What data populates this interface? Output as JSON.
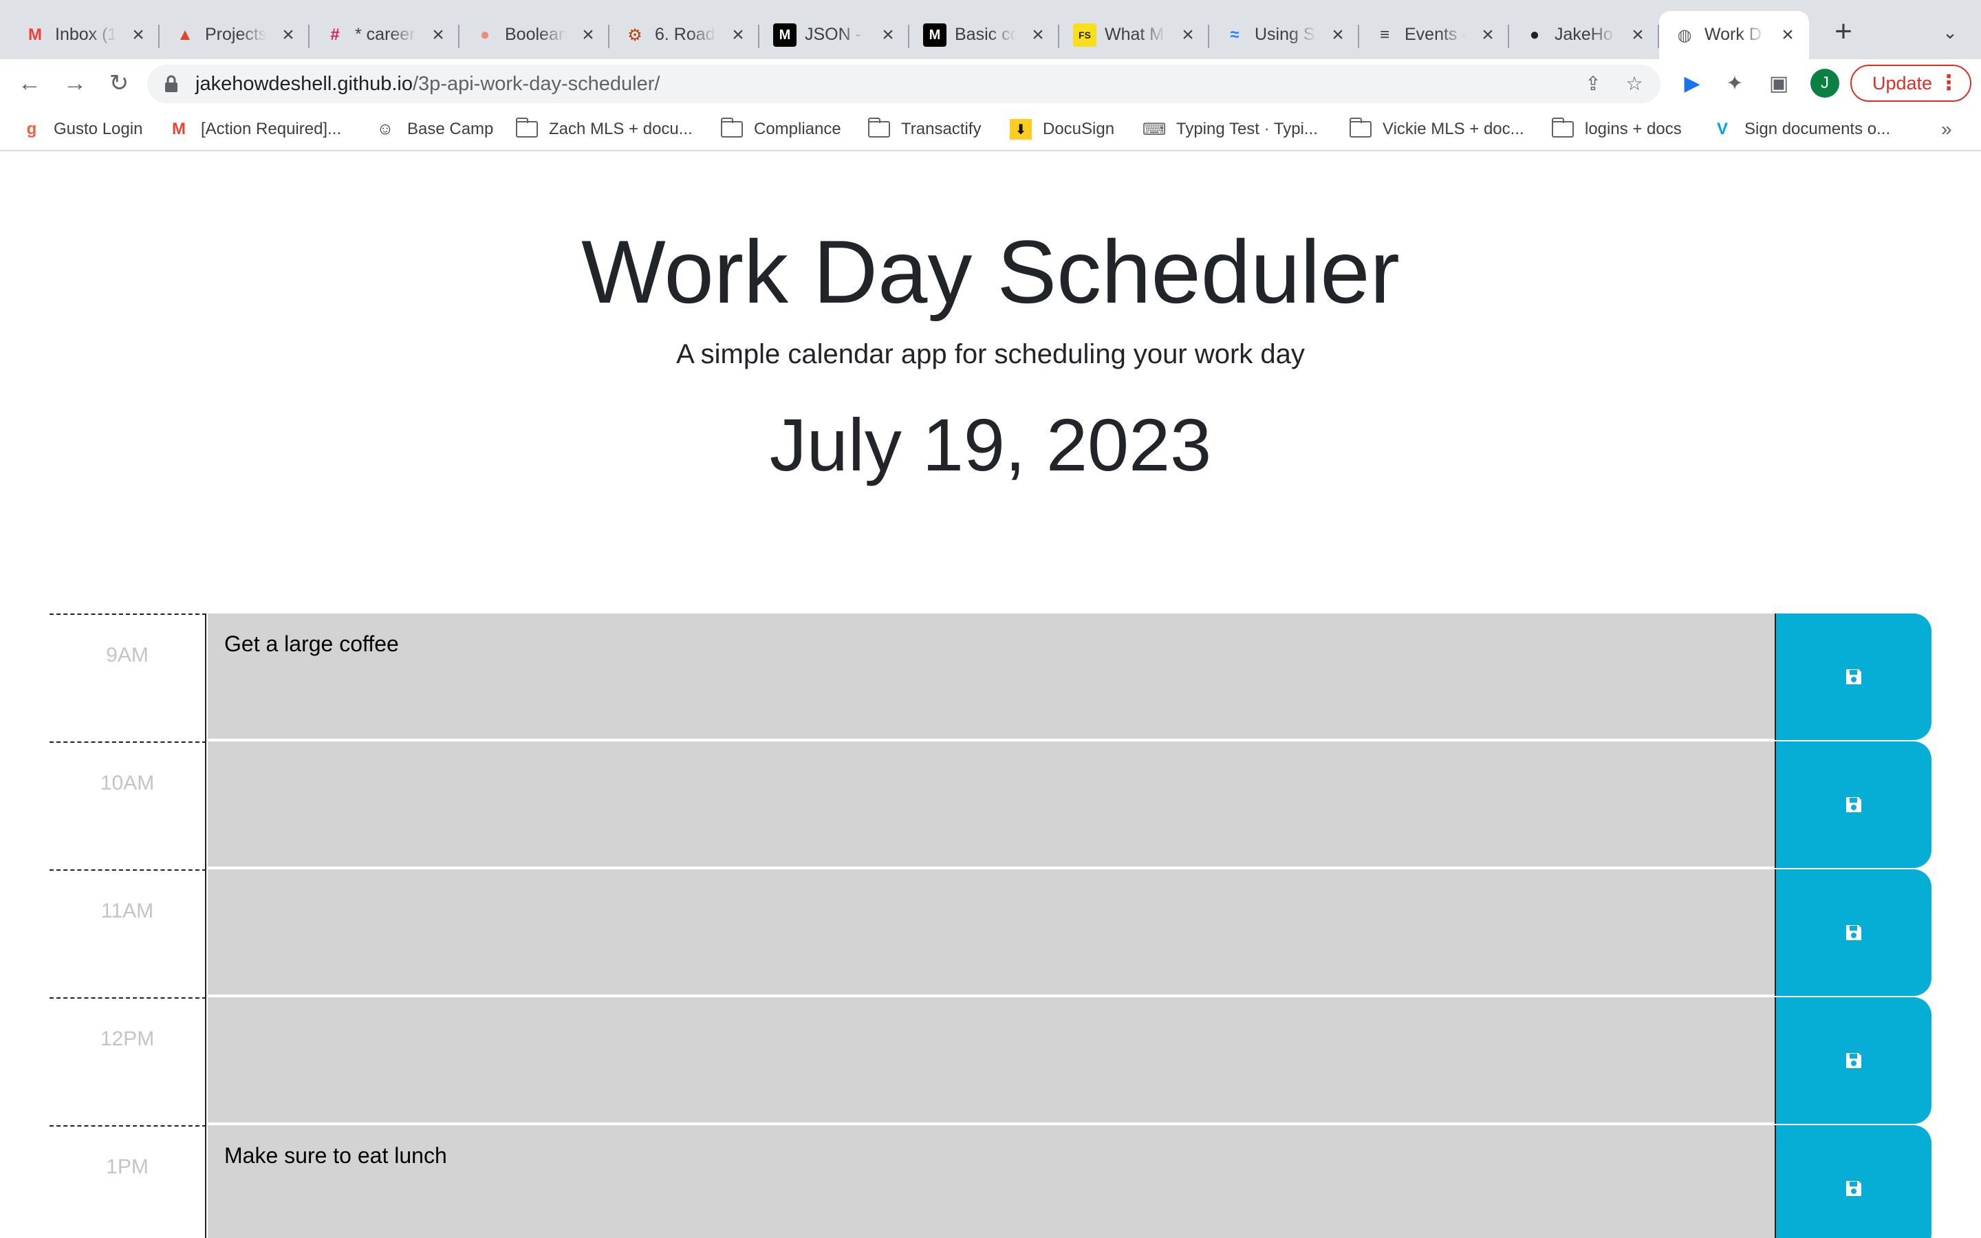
{
  "browser": {
    "tabs": [
      {
        "title": "Inbox (1",
        "icon": "gmail-icon",
        "fav": "M",
        "fav_color": "#ea4335"
      },
      {
        "title": "Projects",
        "icon": "gitlab-icon",
        "fav": "▲",
        "fav_color": "#e24329"
      },
      {
        "title": "* career",
        "icon": "slack-icon",
        "fav": "#",
        "fav_color": "#e01e5a"
      },
      {
        "title": "Boolean",
        "icon": "circle-icon",
        "fav": "●",
        "fav_color": "#e8907a"
      },
      {
        "title": "6. Road",
        "icon": "rust-icon",
        "fav": "⚙",
        "fav_color": "#b7410e"
      },
      {
        "title": "JSON -",
        "icon": "mdn-icon",
        "fav": "M",
        "fav_color": "#ffffff"
      },
      {
        "title": "Basic co",
        "icon": "mdn-icon",
        "fav": "M",
        "fav_color": "#ffffff"
      },
      {
        "title": "What M",
        "icon": "fs-icon",
        "fav": "FS",
        "fav_color": "#222222"
      },
      {
        "title": "Using S",
        "icon": "confluence-icon",
        "fav": "≈",
        "fav_color": "#2684ff"
      },
      {
        "title": "Events -",
        "icon": "events-icon",
        "fav": "≡",
        "fav_color": "#3c4043"
      },
      {
        "title": "JakeHo",
        "icon": "github-icon",
        "fav": "●",
        "fav_color": "#202124"
      },
      {
        "title": "Work D",
        "icon": "globe-icon",
        "fav": "◍",
        "fav_color": "#5f6368",
        "active": true
      }
    ],
    "url_host": "jakehowdeshell.github.io",
    "url_path": "/3p-api-work-day-scheduler/",
    "avatar_initial": "J",
    "update_label": "Update",
    "bookmarks": [
      {
        "label": "Gusto Login",
        "icon": "gusto-icon",
        "glyph": "g",
        "color": "#f45d48"
      },
      {
        "label": "[Action Required]...",
        "icon": "gmail-icon",
        "glyph": "M",
        "color": "#ea4335"
      },
      {
        "label": "Base Camp",
        "icon": "basecamp-icon",
        "glyph": "☺",
        "color": "#1d2d35"
      },
      {
        "label": "Zach MLS + docu...",
        "icon": "folder-icon",
        "glyph": "",
        "color": "#5f6368"
      },
      {
        "label": "Compliance",
        "icon": "folder-icon",
        "glyph": "",
        "color": "#5f6368"
      },
      {
        "label": "Transactify",
        "icon": "folder-icon",
        "glyph": "",
        "color": "#5f6368"
      },
      {
        "label": "DocuSign",
        "icon": "docusign-icon",
        "glyph": "⬇",
        "color": "#1a1a1a"
      },
      {
        "label": "Typing Test · Typi...",
        "icon": "typewriter-icon",
        "glyph": "⌨",
        "color": "#5f6368"
      },
      {
        "label": "Vickie MLS + doc...",
        "icon": "folder-icon",
        "glyph": "",
        "color": "#5f6368"
      },
      {
        "label": "logins + docs",
        "icon": "folder-icon",
        "glyph": "",
        "color": "#5f6368"
      },
      {
        "label": "Sign documents o...",
        "icon": "dotloop-icon",
        "glyph": "V",
        "color": "#00a3e0"
      }
    ]
  },
  "page": {
    "title": "Work Day Scheduler",
    "subtitle": "A simple calendar app for scheduling your work day",
    "date": "July 19, 2023",
    "hours": [
      {
        "label": "9AM",
        "text": "Get a large coffee"
      },
      {
        "label": "10AM",
        "text": ""
      },
      {
        "label": "11AM",
        "text": ""
      },
      {
        "label": "12PM",
        "text": ""
      },
      {
        "label": "1PM",
        "text": "Make sure to eat lunch"
      }
    ],
    "colors": {
      "past": "#d3d3d3",
      "save": "#06aed5",
      "hour_label": "#c4c4c4"
    }
  }
}
